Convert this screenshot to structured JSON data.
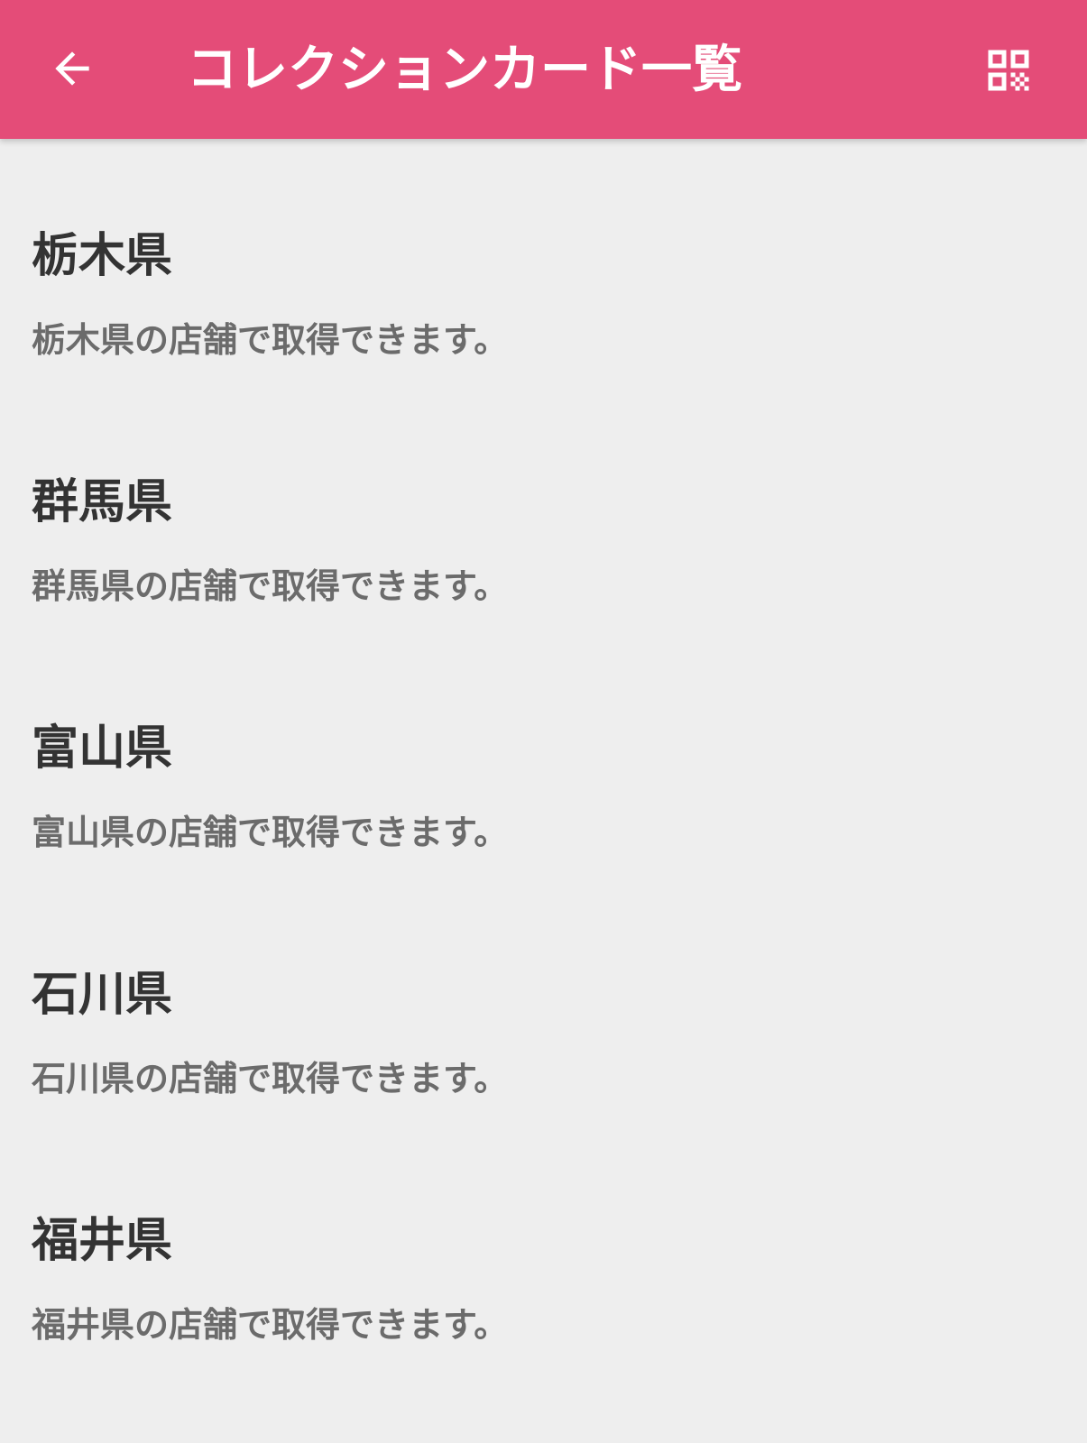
{
  "header": {
    "title": "コレクションカード一覧",
    "back_icon": "arrow-left-icon",
    "qr_icon": "qr-code-icon",
    "color": "#e44c78"
  },
  "cards": [
    {
      "title": "栃木県",
      "description": "栃木県の店舗で取得できます。"
    },
    {
      "title": "群馬県",
      "description": "群馬県の店舗で取得できます。"
    },
    {
      "title": "富山県",
      "description": "富山県の店舗で取得できます。"
    },
    {
      "title": "石川県",
      "description": "石川県の店舗で取得できます。"
    },
    {
      "title": "福井県",
      "description": "福井県の店舗で取得できます。"
    }
  ]
}
